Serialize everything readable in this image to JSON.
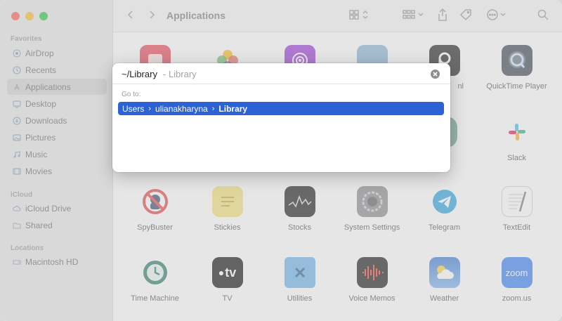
{
  "window": {
    "title": "Applications"
  },
  "sidebar": {
    "sections": [
      {
        "heading": "Favorites",
        "items": [
          {
            "label": "AirDrop",
            "icon": "airdrop-icon"
          },
          {
            "label": "Recents",
            "icon": "clock-icon"
          },
          {
            "label": "Applications",
            "icon": "applications-icon",
            "selected": true
          },
          {
            "label": "Desktop",
            "icon": "desktop-icon"
          },
          {
            "label": "Downloads",
            "icon": "download-icon"
          },
          {
            "label": "Pictures",
            "icon": "pictures-icon"
          },
          {
            "label": "Music",
            "icon": "music-icon"
          },
          {
            "label": "Movies",
            "icon": "movies-icon"
          }
        ]
      },
      {
        "heading": "iCloud",
        "items": [
          {
            "label": "iCloud Drive",
            "icon": "cloud-icon"
          },
          {
            "label": "Shared",
            "icon": "shared-folder-icon"
          }
        ]
      },
      {
        "heading": "Locations",
        "items": [
          {
            "label": "Macintosh HD",
            "icon": "disk-icon"
          }
        ]
      }
    ]
  },
  "apps_row1_visible": [
    {
      "label": "QuickTime Player",
      "icon": "quicktime-icon"
    }
  ],
  "apps_row2_visible": [
    {
      "label": "Slack",
      "icon": "slack-icon"
    }
  ],
  "apps_row3": [
    {
      "label": "SpyBuster",
      "icon": "spybuster-icon"
    },
    {
      "label": "Stickies",
      "icon": "stickies-icon"
    },
    {
      "label": "Stocks",
      "icon": "stocks-icon"
    },
    {
      "label": "System Settings",
      "icon": "system-settings-icon"
    },
    {
      "label": "Telegram",
      "icon": "telegram-icon"
    },
    {
      "label": "TextEdit",
      "icon": "textedit-icon"
    }
  ],
  "apps_row4": [
    {
      "label": "Time Machine",
      "icon": "time-machine-icon"
    },
    {
      "label": "TV",
      "icon": "tv-icon"
    },
    {
      "label": "Utilities",
      "icon": "utilities-folder-icon"
    },
    {
      "label": "Voice Memos",
      "icon": "voice-memos-icon"
    },
    {
      "label": "Weather",
      "icon": "weather-icon"
    },
    {
      "label": "zoom.us",
      "icon": "zoom-icon"
    }
  ],
  "partial_label": "nl",
  "goto": {
    "input_value": "~/Library",
    "hint": "- Library",
    "section_label": "Go to:",
    "suggestion": {
      "parts": [
        "Users",
        "ulianakharyna"
      ],
      "current": "Library",
      "separator": "›"
    }
  },
  "icons": {
    "tv_text": "tv",
    "zoom_text": "zoom"
  },
  "colors": {
    "selection": "#2d62d6",
    "accent_blue": "#3a82f6"
  }
}
